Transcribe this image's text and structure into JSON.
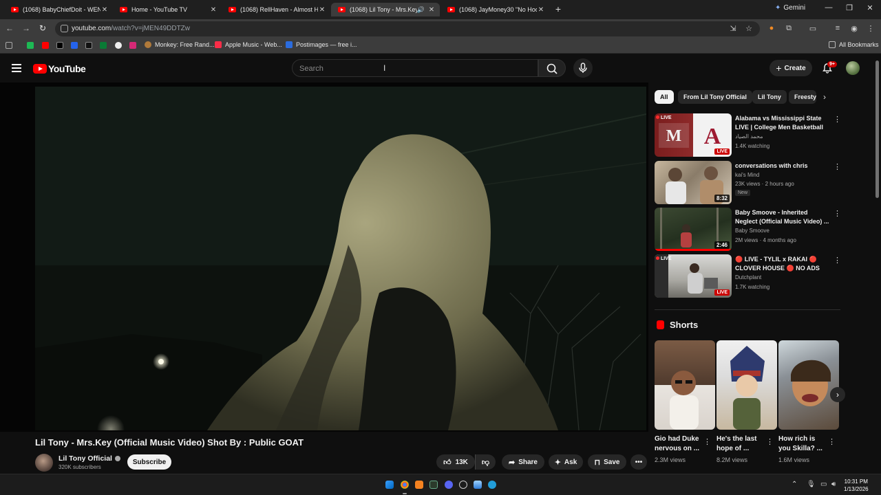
{
  "browser": {
    "tabs": [
      {
        "label": "(1068) BabyChiefDoit - WENT V"
      },
      {
        "label": "Home - YouTube TV"
      },
      {
        "label": "(1068) RellHaven - Almost Had"
      },
      {
        "label": "(1068) Lil Tony - Mrs.Key (O"
      },
      {
        "label": "(1068) JayMoney30 \"No Hook\""
      }
    ],
    "gemini_label": "Gemini",
    "url_host": "youtube.com",
    "url_path": "/watch?v=jMEN49DDTZw",
    "bookmarks": [
      {
        "label": "Monkey: Free Rand..."
      },
      {
        "label": "Apple Music - Web..."
      },
      {
        "label": "Postimages — free i..."
      }
    ],
    "all_bookmarks": "All Bookmarks"
  },
  "header": {
    "logo_text": "YouTube",
    "search_placeholder": "Search",
    "create_label": "Create",
    "notifications_badge": "9+"
  },
  "video": {
    "title": "Lil Tony - Mrs.Key (Official Music Video) Shot By : Public GOAT",
    "channel_name": "Lil Tony Official",
    "subscribers": "320K subscribers",
    "subscribe_label": "Subscribe",
    "likes": "13K",
    "share_label": "Share",
    "ask_label": "Ask",
    "save_label": "Save"
  },
  "sidebar": {
    "chips": [
      "All",
      "From Lil Tony Official",
      "Lil Tony",
      "Freesty"
    ],
    "recommendations": [
      {
        "title": "Alabama vs Mississippi State LIVE | College Men Basketball ...",
        "channel": "محمد الصياد",
        "meta": "1.4K watching",
        "live": true,
        "badge": "LIVE"
      },
      {
        "title": "conversations with chris",
        "channel": "kai's Mind",
        "meta": "23K views · 2 hours ago",
        "duration": "8:32",
        "new_label": "New"
      },
      {
        "title": "Baby Smoove - Inherited Neglect (Official Music Video) ...",
        "channel": "Baby Smoove",
        "meta": "2M views · 4 months ago",
        "duration": "2:46",
        "progress": 1.0
      },
      {
        "title": "🔴 LIVE - TYLIL x RAKAI 🔴 CLOVER HOUSE 🔴 NO ADS",
        "channel": "Dutchplant",
        "meta": "1.7K watching",
        "live": true,
        "badge": "LIVE"
      }
    ],
    "shorts_heading": "Shorts",
    "shorts": [
      {
        "title": "Gio had Duke nervous on ...",
        "views": "2.3M views"
      },
      {
        "title": "He's the last hope of ...",
        "views": "8.2M views"
      },
      {
        "title": "How rich is you Skilla? ...",
        "views": "1.6M views"
      }
    ]
  },
  "taskbar": {
    "time": "10:31 PM",
    "date": "1/13/2026"
  }
}
